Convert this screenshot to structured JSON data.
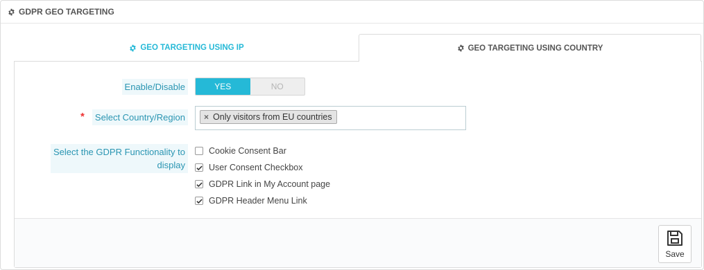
{
  "panel": {
    "title": "GDPR GEO TARGETING",
    "icon": "gear-icon"
  },
  "tabs": [
    {
      "label": "GEO TARGETING USING IP",
      "active": false,
      "color": "#25b9d7"
    },
    {
      "label": "GEO TARGETING USING COUNTRY",
      "active": true,
      "color": "#555555"
    }
  ],
  "form": {
    "enable_label": "Enable/Disable",
    "enable_yes": "YES",
    "enable_no": "NO",
    "enable_value": "YES",
    "required_mark": "*",
    "country_label": "Select Country/Region",
    "country_selected": [
      "Only visitors from EU countries"
    ],
    "functionality_label_line1": "Select the GDPR Functionality to",
    "functionality_label_line2": "display",
    "options": [
      {
        "label": "Cookie Consent Bar",
        "checked": false
      },
      {
        "label": "User Consent Checkbox",
        "checked": true
      },
      {
        "label": "GDPR Link in My Account page",
        "checked": true
      },
      {
        "label": "GDPR Header Menu Link",
        "checked": true
      }
    ]
  },
  "footer": {
    "save_label": "Save",
    "save_icon": "floppy-disk-icon"
  },
  "colors": {
    "accent": "#25b9d7",
    "label_bg": "#eef8fb",
    "label_text": "#2a95b2",
    "required": "#e33333"
  }
}
